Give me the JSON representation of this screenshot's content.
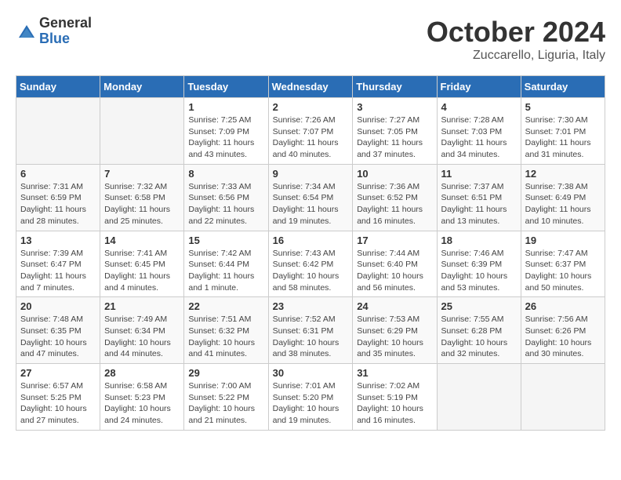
{
  "header": {
    "logo_general": "General",
    "logo_blue": "Blue",
    "month_title": "October 2024",
    "location": "Zuccarello, Liguria, Italy"
  },
  "days_of_week": [
    "Sunday",
    "Monday",
    "Tuesday",
    "Wednesday",
    "Thursday",
    "Friday",
    "Saturday"
  ],
  "weeks": [
    [
      {
        "num": "",
        "sunrise": "",
        "sunset": "",
        "daylight": "",
        "empty": true
      },
      {
        "num": "",
        "sunrise": "",
        "sunset": "",
        "daylight": "",
        "empty": true
      },
      {
        "num": "1",
        "sunrise": "Sunrise: 7:25 AM",
        "sunset": "Sunset: 7:09 PM",
        "daylight": "Daylight: 11 hours and 43 minutes.",
        "empty": false
      },
      {
        "num": "2",
        "sunrise": "Sunrise: 7:26 AM",
        "sunset": "Sunset: 7:07 PM",
        "daylight": "Daylight: 11 hours and 40 minutes.",
        "empty": false
      },
      {
        "num": "3",
        "sunrise": "Sunrise: 7:27 AM",
        "sunset": "Sunset: 7:05 PM",
        "daylight": "Daylight: 11 hours and 37 minutes.",
        "empty": false
      },
      {
        "num": "4",
        "sunrise": "Sunrise: 7:28 AM",
        "sunset": "Sunset: 7:03 PM",
        "daylight": "Daylight: 11 hours and 34 minutes.",
        "empty": false
      },
      {
        "num": "5",
        "sunrise": "Sunrise: 7:30 AM",
        "sunset": "Sunset: 7:01 PM",
        "daylight": "Daylight: 11 hours and 31 minutes.",
        "empty": false
      }
    ],
    [
      {
        "num": "6",
        "sunrise": "Sunrise: 7:31 AM",
        "sunset": "Sunset: 6:59 PM",
        "daylight": "Daylight: 11 hours and 28 minutes.",
        "empty": false
      },
      {
        "num": "7",
        "sunrise": "Sunrise: 7:32 AM",
        "sunset": "Sunset: 6:58 PM",
        "daylight": "Daylight: 11 hours and 25 minutes.",
        "empty": false
      },
      {
        "num": "8",
        "sunrise": "Sunrise: 7:33 AM",
        "sunset": "Sunset: 6:56 PM",
        "daylight": "Daylight: 11 hours and 22 minutes.",
        "empty": false
      },
      {
        "num": "9",
        "sunrise": "Sunrise: 7:34 AM",
        "sunset": "Sunset: 6:54 PM",
        "daylight": "Daylight: 11 hours and 19 minutes.",
        "empty": false
      },
      {
        "num": "10",
        "sunrise": "Sunrise: 7:36 AM",
        "sunset": "Sunset: 6:52 PM",
        "daylight": "Daylight: 11 hours and 16 minutes.",
        "empty": false
      },
      {
        "num": "11",
        "sunrise": "Sunrise: 7:37 AM",
        "sunset": "Sunset: 6:51 PM",
        "daylight": "Daylight: 11 hours and 13 minutes.",
        "empty": false
      },
      {
        "num": "12",
        "sunrise": "Sunrise: 7:38 AM",
        "sunset": "Sunset: 6:49 PM",
        "daylight": "Daylight: 11 hours and 10 minutes.",
        "empty": false
      }
    ],
    [
      {
        "num": "13",
        "sunrise": "Sunrise: 7:39 AM",
        "sunset": "Sunset: 6:47 PM",
        "daylight": "Daylight: 11 hours and 7 minutes.",
        "empty": false
      },
      {
        "num": "14",
        "sunrise": "Sunrise: 7:41 AM",
        "sunset": "Sunset: 6:45 PM",
        "daylight": "Daylight: 11 hours and 4 minutes.",
        "empty": false
      },
      {
        "num": "15",
        "sunrise": "Sunrise: 7:42 AM",
        "sunset": "Sunset: 6:44 PM",
        "daylight": "Daylight: 11 hours and 1 minute.",
        "empty": false
      },
      {
        "num": "16",
        "sunrise": "Sunrise: 7:43 AM",
        "sunset": "Sunset: 6:42 PM",
        "daylight": "Daylight: 10 hours and 58 minutes.",
        "empty": false
      },
      {
        "num": "17",
        "sunrise": "Sunrise: 7:44 AM",
        "sunset": "Sunset: 6:40 PM",
        "daylight": "Daylight: 10 hours and 56 minutes.",
        "empty": false
      },
      {
        "num": "18",
        "sunrise": "Sunrise: 7:46 AM",
        "sunset": "Sunset: 6:39 PM",
        "daylight": "Daylight: 10 hours and 53 minutes.",
        "empty": false
      },
      {
        "num": "19",
        "sunrise": "Sunrise: 7:47 AM",
        "sunset": "Sunset: 6:37 PM",
        "daylight": "Daylight: 10 hours and 50 minutes.",
        "empty": false
      }
    ],
    [
      {
        "num": "20",
        "sunrise": "Sunrise: 7:48 AM",
        "sunset": "Sunset: 6:35 PM",
        "daylight": "Daylight: 10 hours and 47 minutes.",
        "empty": false
      },
      {
        "num": "21",
        "sunrise": "Sunrise: 7:49 AM",
        "sunset": "Sunset: 6:34 PM",
        "daylight": "Daylight: 10 hours and 44 minutes.",
        "empty": false
      },
      {
        "num": "22",
        "sunrise": "Sunrise: 7:51 AM",
        "sunset": "Sunset: 6:32 PM",
        "daylight": "Daylight: 10 hours and 41 minutes.",
        "empty": false
      },
      {
        "num": "23",
        "sunrise": "Sunrise: 7:52 AM",
        "sunset": "Sunset: 6:31 PM",
        "daylight": "Daylight: 10 hours and 38 minutes.",
        "empty": false
      },
      {
        "num": "24",
        "sunrise": "Sunrise: 7:53 AM",
        "sunset": "Sunset: 6:29 PM",
        "daylight": "Daylight: 10 hours and 35 minutes.",
        "empty": false
      },
      {
        "num": "25",
        "sunrise": "Sunrise: 7:55 AM",
        "sunset": "Sunset: 6:28 PM",
        "daylight": "Daylight: 10 hours and 32 minutes.",
        "empty": false
      },
      {
        "num": "26",
        "sunrise": "Sunrise: 7:56 AM",
        "sunset": "Sunset: 6:26 PM",
        "daylight": "Daylight: 10 hours and 30 minutes.",
        "empty": false
      }
    ],
    [
      {
        "num": "27",
        "sunrise": "Sunrise: 6:57 AM",
        "sunset": "Sunset: 5:25 PM",
        "daylight": "Daylight: 10 hours and 27 minutes.",
        "empty": false
      },
      {
        "num": "28",
        "sunrise": "Sunrise: 6:58 AM",
        "sunset": "Sunset: 5:23 PM",
        "daylight": "Daylight: 10 hours and 24 minutes.",
        "empty": false
      },
      {
        "num": "29",
        "sunrise": "Sunrise: 7:00 AM",
        "sunset": "Sunset: 5:22 PM",
        "daylight": "Daylight: 10 hours and 21 minutes.",
        "empty": false
      },
      {
        "num": "30",
        "sunrise": "Sunrise: 7:01 AM",
        "sunset": "Sunset: 5:20 PM",
        "daylight": "Daylight: 10 hours and 19 minutes.",
        "empty": false
      },
      {
        "num": "31",
        "sunrise": "Sunrise: 7:02 AM",
        "sunset": "Sunset: 5:19 PM",
        "daylight": "Daylight: 10 hours and 16 minutes.",
        "empty": false
      },
      {
        "num": "",
        "sunrise": "",
        "sunset": "",
        "daylight": "",
        "empty": true
      },
      {
        "num": "",
        "sunrise": "",
        "sunset": "",
        "daylight": "",
        "empty": true
      }
    ]
  ]
}
